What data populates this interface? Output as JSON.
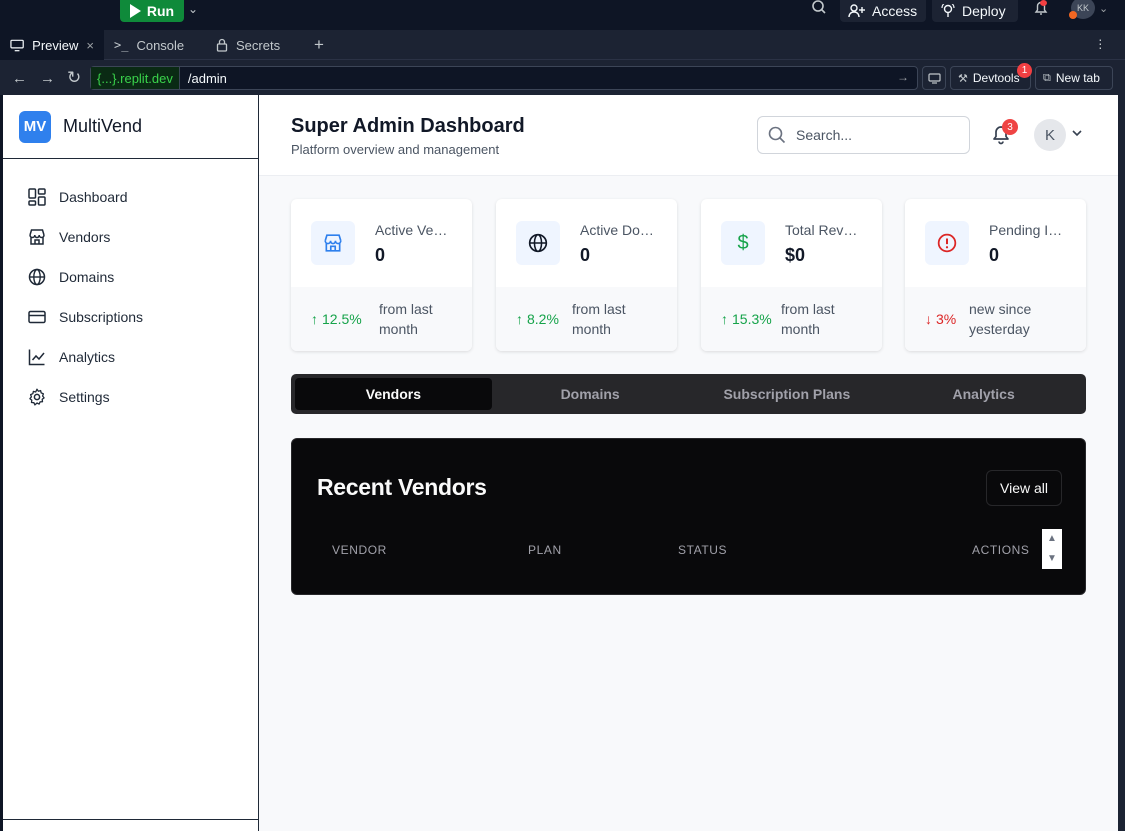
{
  "topbar": {
    "run_label": "Run",
    "access_label": "Access",
    "deploy_label": "Deploy",
    "user_initials": "KK"
  },
  "tabs_strip": {
    "preview": "Preview",
    "console": "Console",
    "secrets": "Secrets"
  },
  "urlbar": {
    "host": "{...}.replit.dev",
    "path": "/admin",
    "devtools_label": "Devtools",
    "devtools_badge": "1",
    "new_tab_label": "New tab"
  },
  "sidebar": {
    "logo": "MV",
    "brand": "MultiVend",
    "items": [
      {
        "label": "Dashboard",
        "icon": "layout-grid-icon"
      },
      {
        "label": "Vendors",
        "icon": "store-icon"
      },
      {
        "label": "Domains",
        "icon": "globe-icon"
      },
      {
        "label": "Subscriptions",
        "icon": "credit-card-icon"
      },
      {
        "label": "Analytics",
        "icon": "line-chart-icon"
      },
      {
        "label": "Settings",
        "icon": "gear-icon"
      }
    ]
  },
  "header": {
    "title": "Super Admin Dashboard",
    "subtitle": "Platform overview and management",
    "search_placeholder": "Search...",
    "notif_count": "3",
    "avatar_initial": "K"
  },
  "stats": [
    {
      "label": "Active Vendors",
      "value": "0",
      "delta": "12.5%",
      "direction": "up",
      "note": "from last month",
      "icon": "store-icon",
      "color": "#2f80ed"
    },
    {
      "label": "Active Domains",
      "value": "0",
      "delta": "8.2%",
      "direction": "up",
      "note": "from last month",
      "icon": "globe-icon",
      "color": "#111827"
    },
    {
      "label": "Total Revenue",
      "value": "$0",
      "delta": "15.3%",
      "direction": "up",
      "note": "from last month",
      "icon": "dollar-icon",
      "color": "#16a34a"
    },
    {
      "label": "Pending Issues",
      "value": "0",
      "delta": "3%",
      "direction": "down",
      "note": "new since yesterday",
      "icon": "alert-circle-icon",
      "color": "#dc2626"
    }
  ],
  "main_tabs": [
    {
      "label": "Vendors",
      "active": true
    },
    {
      "label": "Domains",
      "active": false
    },
    {
      "label": "Subscription Plans",
      "active": false
    },
    {
      "label": "Analytics",
      "active": false
    }
  ],
  "recent_vendors": {
    "title": "Recent Vendors",
    "view_all": "View all",
    "columns": [
      "VENDOR",
      "PLAN",
      "STATUS",
      "ACTIONS"
    ]
  }
}
